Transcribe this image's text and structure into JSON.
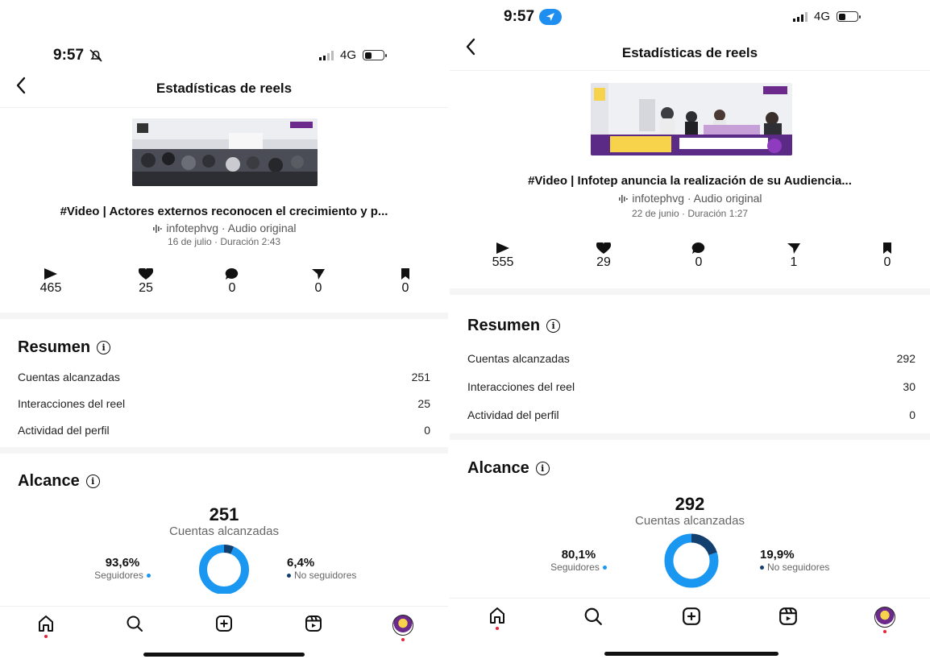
{
  "screens": [
    {
      "status": {
        "time": "9:57",
        "network": "4G"
      },
      "header": {
        "title": "Estadísticas de reels"
      },
      "reel": {
        "title": "#Video |  Actores externos reconocen el crecimiento y p...",
        "audio": "infotephvg · Audio original",
        "date": "16 de julio · Duración 2:43"
      },
      "stats": {
        "plays": "465",
        "likes": "25",
        "comments": "0",
        "shares": "0",
        "saves": "0"
      },
      "summary": {
        "title": "Resumen",
        "rows": [
          {
            "label": "Cuentas alcanzadas",
            "value": "251"
          },
          {
            "label": "Interacciones del reel",
            "value": "25"
          },
          {
            "label": "Actividad del perfil",
            "value": "0"
          }
        ]
      },
      "reach": {
        "title": "Alcance",
        "total": "251",
        "total_label": "Cuentas alcanzadas",
        "followers_pct": "93,6%",
        "followers_label": "Seguidores",
        "followers_fraction": 0.936,
        "nonfollowers_pct": "6,4%",
        "nonfollowers_label": "No seguidores"
      }
    },
    {
      "status": {
        "time": "9:57",
        "network": "4G"
      },
      "header": {
        "title": "Estadísticas de reels"
      },
      "reel": {
        "title": "#Video |  Infotep anuncia la realización de su Audiencia...",
        "audio": "infotephvg · Audio original",
        "date": "22 de junio · Duración 1:27"
      },
      "stats": {
        "plays": "555",
        "likes": "29",
        "comments": "0",
        "shares": "1",
        "saves": "0"
      },
      "summary": {
        "title": "Resumen",
        "rows": [
          {
            "label": "Cuentas alcanzadas",
            "value": "292"
          },
          {
            "label": "Interacciones del reel",
            "value": "30"
          },
          {
            "label": "Actividad del perfil",
            "value": "0"
          }
        ]
      },
      "reach": {
        "title": "Alcance",
        "total": "292",
        "total_label": "Cuentas alcanzadas",
        "followers_pct": "80,1%",
        "followers_label": "Seguidores",
        "followers_fraction": 0.801,
        "nonfollowers_pct": "19,9%",
        "nonfollowers_label": "No seguidores"
      }
    }
  ],
  "colors": {
    "followers": "#1a97f0",
    "nonfollowers": "#123f6e",
    "accent_blue": "#1f8ef1"
  },
  "icons": [
    "back-icon",
    "play-icon",
    "heart-icon",
    "comment-icon",
    "share-icon",
    "save-icon",
    "info-icon",
    "home-icon",
    "search-icon",
    "create-icon",
    "reels-icon",
    "profile-avatar"
  ]
}
